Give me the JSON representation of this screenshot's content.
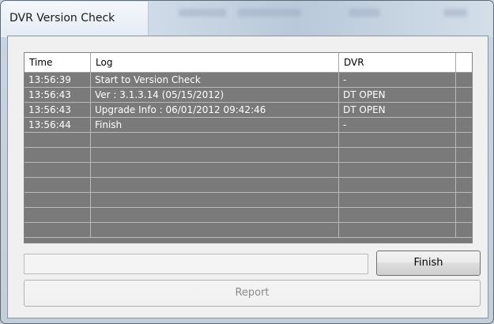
{
  "window": {
    "title": "DVR Version Check"
  },
  "table": {
    "columns": [
      "Time",
      "Log",
      "DVR",
      ""
    ],
    "rows": [
      {
        "time": "13:56:39",
        "log": "Start to Version Check",
        "dvr": "-"
      },
      {
        "time": "13:56:43",
        "log": "Ver : 3.1.3.14 (05/15/2012)",
        "dvr": "DT OPEN"
      },
      {
        "time": "13:56:43",
        "log": "Upgrade Info : 06/01/2012 09:42:46",
        "dvr": "DT OPEN"
      },
      {
        "time": "13:56:44",
        "log": "Finish",
        "dvr": "-"
      },
      {
        "time": "",
        "log": "",
        "dvr": ""
      },
      {
        "time": "",
        "log": "",
        "dvr": ""
      },
      {
        "time": "",
        "log": "",
        "dvr": ""
      },
      {
        "time": "",
        "log": "",
        "dvr": ""
      },
      {
        "time": "",
        "log": "",
        "dvr": ""
      },
      {
        "time": "",
        "log": "",
        "dvr": ""
      },
      {
        "time": "",
        "log": "",
        "dvr": ""
      }
    ]
  },
  "progress": {
    "value_percent": 0
  },
  "buttons": {
    "finish_label": "Finish",
    "report_label": "Report",
    "report_enabled": false
  },
  "colors": {
    "row_background": "#7a7a7a",
    "row_text": "#ffffff",
    "header_background": "#ffffff"
  }
}
